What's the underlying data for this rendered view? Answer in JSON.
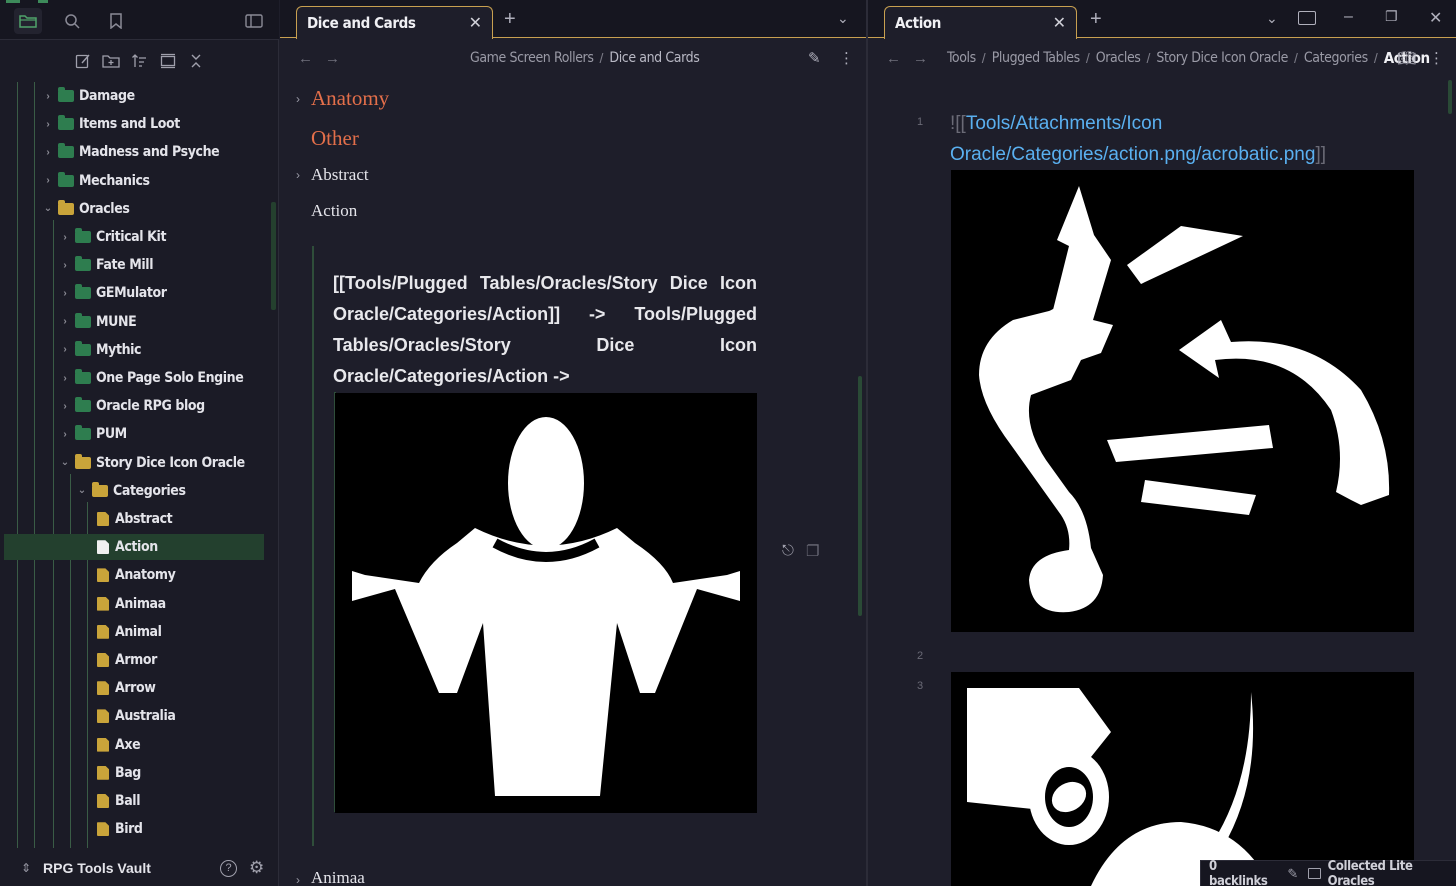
{
  "sidebar": {
    "vault_name": "RPG Tools Vault",
    "tree": [
      {
        "label": "Damage",
        "kind": "folder-green",
        "depth": 0,
        "expanded": false
      },
      {
        "label": "Items and Loot",
        "kind": "folder-green",
        "depth": 0,
        "expanded": false
      },
      {
        "label": "Madness and Psyche",
        "kind": "folder-green",
        "depth": 0,
        "expanded": false
      },
      {
        "label": "Mechanics",
        "kind": "folder-green",
        "depth": 0,
        "expanded": false
      },
      {
        "label": "Oracles",
        "kind": "folder-gold",
        "depth": 0,
        "expanded": true
      },
      {
        "label": "Critical Kit",
        "kind": "folder-green",
        "depth": 1,
        "expanded": false
      },
      {
        "label": "Fate Mill",
        "kind": "folder-green",
        "depth": 1,
        "expanded": false
      },
      {
        "label": "GEMulator",
        "kind": "folder-green",
        "depth": 1,
        "expanded": false
      },
      {
        "label": "MUNE",
        "kind": "folder-green",
        "depth": 1,
        "expanded": false
      },
      {
        "label": "Mythic",
        "kind": "folder-green",
        "depth": 1,
        "expanded": false
      },
      {
        "label": "One Page Solo Engine",
        "kind": "folder-green",
        "depth": 1,
        "expanded": false
      },
      {
        "label": "Oracle RPG blog",
        "kind": "folder-green",
        "depth": 1,
        "expanded": false
      },
      {
        "label": "PUM",
        "kind": "folder-green",
        "depth": 1,
        "expanded": false
      },
      {
        "label": "Story Dice Icon Oracle",
        "kind": "folder-gold",
        "depth": 1,
        "expanded": true
      },
      {
        "label": "Categories",
        "kind": "folder-gold",
        "depth": 2,
        "expanded": true
      },
      {
        "label": "Abstract",
        "kind": "file-gold",
        "depth": 3
      },
      {
        "label": "Action",
        "kind": "file-white",
        "depth": 3,
        "selected": true
      },
      {
        "label": "Anatomy",
        "kind": "file-gold",
        "depth": 3
      },
      {
        "label": "Animaa",
        "kind": "file-gold",
        "depth": 3
      },
      {
        "label": "Animal",
        "kind": "file-gold",
        "depth": 3
      },
      {
        "label": "Armor",
        "kind": "file-gold",
        "depth": 3
      },
      {
        "label": "Arrow",
        "kind": "file-gold",
        "depth": 3
      },
      {
        "label": "Australia",
        "kind": "file-gold",
        "depth": 3
      },
      {
        "label": "Axe",
        "kind": "file-gold",
        "depth": 3
      },
      {
        "label": "Bag",
        "kind": "file-gold",
        "depth": 3
      },
      {
        "label": "Ball",
        "kind": "file-gold",
        "depth": 3
      },
      {
        "label": "Bird",
        "kind": "file-gold",
        "depth": 3
      }
    ]
  },
  "pane_left": {
    "tab_title": "Dice and Cards",
    "breadcrumb": [
      "Game Screen Rollers",
      "Dice and Cards"
    ],
    "headings": {
      "anatomy": "Anatomy",
      "other": "Other",
      "abstract": "Abstract",
      "action": "Action",
      "animaa": "Animaa"
    },
    "embed_text": "[[Tools/Plugged Tables/Oracles/Story Dice Icon Oracle/Categories/Action]] -> Tools/Plugged Tables/Oracles/Story Dice Icon Oracle/Categories/Action ->"
  },
  "pane_right": {
    "tab_title": "Action",
    "breadcrumb": [
      "Tools",
      "Plugged Tables",
      "Oracles",
      "Story Dice Icon Oracle",
      "Categories"
    ],
    "breadcrumb_current": "Action",
    "line_numbers": [
      "1",
      "2",
      "3"
    ],
    "link_prefix": "![[",
    "link_path": "Tools/Attachments/Icon Oracle/Categories/action.png/acrobatic.png",
    "link_suffix": "]]"
  },
  "status_bar": {
    "backlinks": "0 backlinks",
    "plugin": "Collected Lite Oracles"
  },
  "colors": {
    "accent_green": "#2e7d4f",
    "folder_gold": "#c9a43a",
    "heading_orange": "#e36f4a",
    "link_blue": "#5ab0f0",
    "tab_border": "#c8a050"
  }
}
